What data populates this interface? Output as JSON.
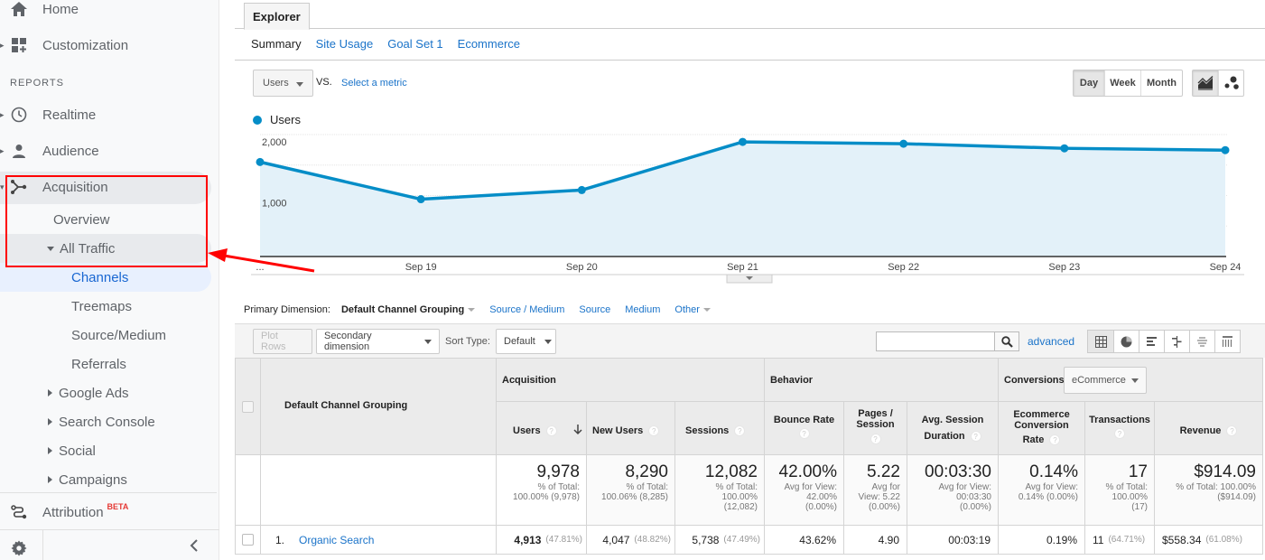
{
  "sidebar": {
    "home": "Home",
    "customization": "Customization",
    "reports_heading": "REPORTS",
    "realtime": "Realtime",
    "audience": "Audience",
    "acquisition": "Acquisition",
    "overview": "Overview",
    "all_traffic": "All Traffic",
    "channels": "Channels",
    "treemaps": "Treemaps",
    "source_medium": "Source/Medium",
    "referrals": "Referrals",
    "google_ads": "Google Ads",
    "search_console": "Search Console",
    "social": "Social",
    "campaigns": "Campaigns",
    "attribution": "Attribution",
    "beta_badge": "BETA"
  },
  "tabs": {
    "explorer": "Explorer",
    "subtabs": [
      "Summary",
      "Site Usage",
      "Goal Set 1",
      "Ecommerce"
    ]
  },
  "controls": {
    "metric": "Users",
    "vs": "VS.",
    "select_metric": "Select a metric",
    "time_buttons": [
      "Day",
      "Week",
      "Month"
    ],
    "selected_time": "Day"
  },
  "chart_data": {
    "type": "area",
    "legend": [
      {
        "name": "Users",
        "color": "#058dc7"
      }
    ],
    "x": [
      "...",
      "Sep 19",
      "Sep 20",
      "Sep 21",
      "Sep 22",
      "Sep 23",
      "Sep 24"
    ],
    "series": [
      {
        "name": "Users",
        "values": [
          1550,
          940,
          1090,
          1880,
          1850,
          1775,
          1745
        ]
      }
    ],
    "yticks": [
      {
        "value": 1000,
        "label": "1,000"
      },
      {
        "value": 2000,
        "label": "2,000"
      }
    ],
    "ylim": [
      0,
      2000
    ],
    "grid": true
  },
  "primary_dimension": {
    "label": "Primary Dimension:",
    "current": "Default Channel Grouping",
    "links": [
      "Source / Medium",
      "Source",
      "Medium",
      "Other"
    ]
  },
  "toolbar": {
    "plot_rows": "Plot Rows",
    "secondary_dimension": "Secondary dimension",
    "sort_type_label": "Sort Type:",
    "sort_type_value": "Default",
    "search_placeholder": "",
    "advanced": "advanced"
  },
  "table": {
    "dim_header": "Default Channel Grouping",
    "groups": {
      "acquisition": "Acquisition",
      "behavior": "Behavior",
      "conversions": "Conversions",
      "conversions_select": "eCommerce"
    },
    "columns": {
      "users": "Users",
      "new_users": "New Users",
      "sessions": "Sessions",
      "bounce_rate": "Bounce Rate",
      "pages_session_1": "Pages /",
      "pages_session_2": "Session",
      "avg_dur_1": "Avg. Session",
      "avg_dur_2": "Duration",
      "ecr_1": "Ecommerce",
      "ecr_2": "Conversion",
      "ecr_3": "Rate",
      "transactions": "Transactions",
      "revenue": "Revenue"
    },
    "totals": {
      "users": {
        "value": "9,978",
        "sub": [
          "% of Total:",
          "100.00% (9,978)"
        ]
      },
      "new_users": {
        "value": "8,290",
        "sub": [
          "% of Total:",
          "100.06% (8,285)"
        ]
      },
      "sessions": {
        "value": "12,082",
        "sub": [
          "% of Total:",
          "100.00%",
          "(12,082)"
        ]
      },
      "bounce_rate": {
        "value": "42.00%",
        "sub": [
          "Avg for View:",
          "42.00%",
          "(0.00%)"
        ]
      },
      "pages_session": {
        "value": "5.22",
        "sub": [
          "Avg for",
          "View: 5.22",
          "(0.00%)"
        ]
      },
      "avg_dur": {
        "value": "00:03:30",
        "sub": [
          "Avg for View:",
          "00:03:30",
          "(0.00%)"
        ]
      },
      "ecr": {
        "value": "0.14%",
        "sub": [
          "Avg for View:",
          "0.14% (0.00%)"
        ]
      },
      "transactions": {
        "value": "17",
        "sub": [
          "% of Total:",
          "100.00%",
          "(17)"
        ]
      },
      "revenue": {
        "value": "$914.09",
        "sub": [
          "% of Total: 100.00%",
          "($914.09)"
        ]
      }
    },
    "rows": [
      {
        "index": "1.",
        "name": "Organic Search",
        "users": "4,913",
        "users_pct": "(47.81%)",
        "new_users": "4,047",
        "new_users_pct": "(48.82%)",
        "sessions": "5,738",
        "sessions_pct": "(47.49%)",
        "bounce_rate": "43.62%",
        "pages_session": "4.90",
        "avg_dur": "00:03:19",
        "ecr": "0.19%",
        "transactions": "11",
        "transactions_pct": "(64.71%)",
        "revenue": "$558.34",
        "revenue_pct": "(61.08%)"
      }
    ]
  }
}
